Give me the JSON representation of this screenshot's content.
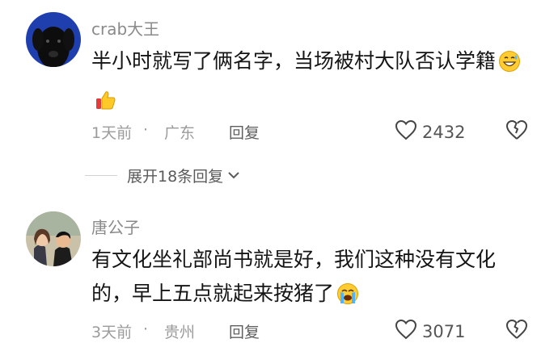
{
  "comments": [
    {
      "username": "crab大王",
      "text": "半小时就写了俩名字，当场被村大队否认学籍",
      "emojis": [
        "grin-sweat-icon",
        "thumbs-up-icon"
      ],
      "time": "1天前",
      "dot": "·",
      "location": "广东",
      "reply_label": "回复",
      "likes": "2432"
    },
    {
      "username": "唐公子",
      "text": "有文化坐礼部尚书就是好，我们这种没有文化的，早上五点就起来按猪了",
      "emojis": [
        "crying-face-icon"
      ],
      "time": "3天前",
      "dot": "·",
      "location": "贵州",
      "reply_label": "回复",
      "likes": "3071"
    }
  ],
  "replies_toggle": {
    "label": "展开18条回复"
  },
  "colors": {
    "meta": "#9b9b9b",
    "username": "#8a8a8a",
    "text": "#151515"
  }
}
